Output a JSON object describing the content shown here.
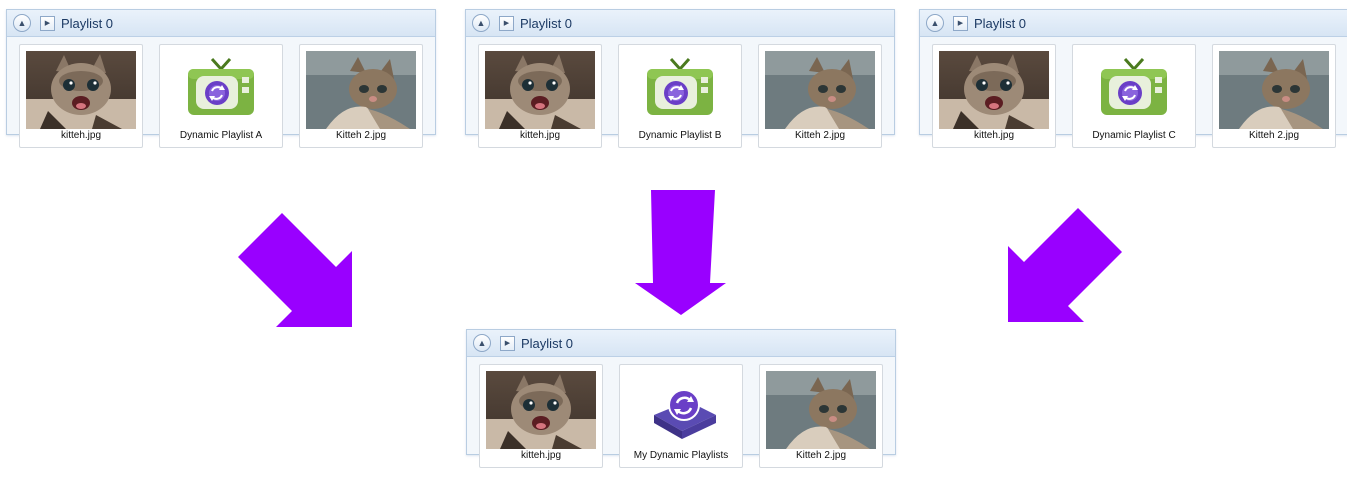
{
  "panels": [
    {
      "title": "Playlist 0",
      "items": [
        {
          "label": "kitteh.jpg",
          "icon": "cat-photo"
        },
        {
          "label": "Dynamic Playlist A",
          "icon": "tv-icon"
        },
        {
          "label": "Kitteh 2.jpg",
          "icon": "cat-photo-2"
        }
      ]
    },
    {
      "title": "Playlist 0",
      "items": [
        {
          "label": "kitteh.jpg",
          "icon": "cat-photo"
        },
        {
          "label": "Dynamic Playlist B",
          "icon": "tv-icon"
        },
        {
          "label": "Kitteh 2.jpg",
          "icon": "cat-photo-2"
        }
      ]
    },
    {
      "title": "Playlist 0",
      "items": [
        {
          "label": "kitteh.jpg",
          "icon": "cat-photo"
        },
        {
          "label": "Dynamic Playlist C",
          "icon": "tv-icon"
        },
        {
          "label": "Kitteh 2.jpg",
          "icon": "cat-photo-2"
        }
      ]
    },
    {
      "title": "Playlist 0",
      "items": [
        {
          "label": "kitteh.jpg",
          "icon": "cat-photo"
        },
        {
          "label": "My Dynamic Playlists",
          "icon": "playlist-box-icon"
        },
        {
          "label": "Kitteh 2.jpg",
          "icon": "cat-photo-2"
        }
      ]
    }
  ],
  "colors": {
    "arrow": "#9900ff",
    "tv_green": "#7cb342",
    "sync_purple": "#6a3fc7",
    "header_text": "#1c3a64"
  },
  "icons": {
    "collapse": "collapse-up-icon",
    "play": "play-icon",
    "arrow": "merge-arrow"
  }
}
